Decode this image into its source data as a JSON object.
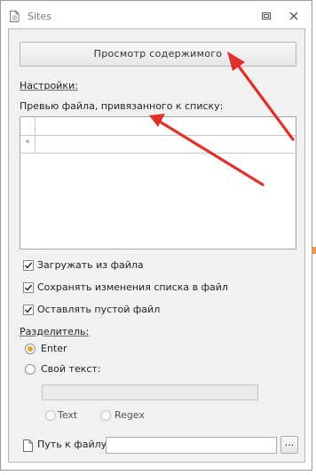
{
  "window": {
    "title": "Sites"
  },
  "main": {
    "view_button_label": "Просмотр содержимого",
    "settings_label": "Настройки:",
    "preview_label": "Превью файла, привязанного к списку:",
    "grid_new_row_marker": "*"
  },
  "options": {
    "checkboxes": [
      {
        "label": "Загружать из файла",
        "checked": true
      },
      {
        "label": "Сохранять изменения списка в файл",
        "checked": true
      },
      {
        "label": "Оставлять пустой файл",
        "checked": true
      }
    ]
  },
  "separator": {
    "label": "Разделитель:",
    "enter_label": "Enter",
    "custom_label": "Свой текст:",
    "custom_value": "",
    "text_label": "Text",
    "regex_label": "Regex",
    "selected": "Enter"
  },
  "file": {
    "path_label": "Путь к файлу",
    "path_value": "",
    "browse_label": "..."
  },
  "colors": {
    "annotation_arrow": "#e0302a",
    "radio_selected": "#e8a12a"
  }
}
